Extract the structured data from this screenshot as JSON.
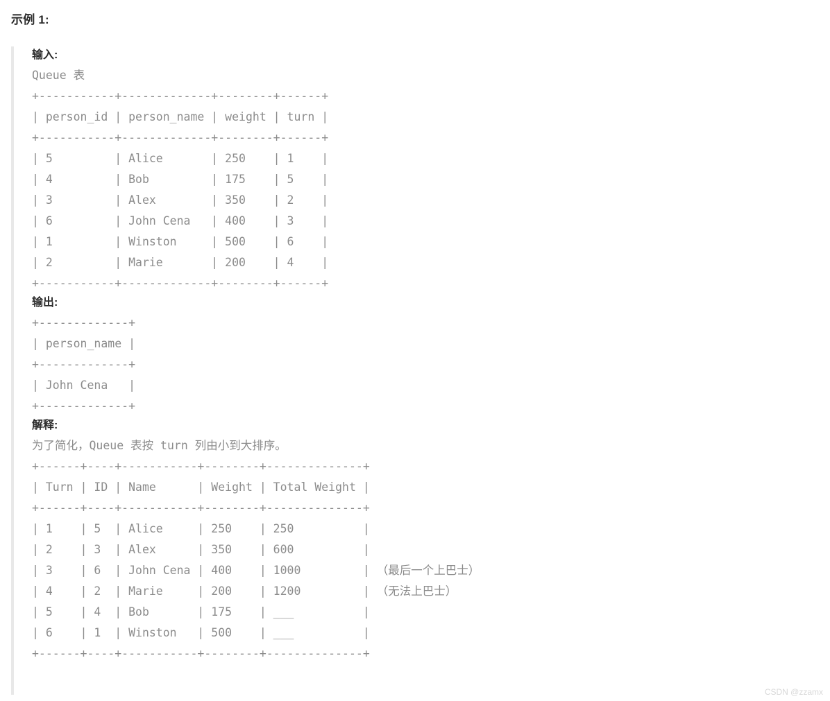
{
  "example": {
    "title": "示例 1:"
  },
  "input": {
    "heading": "输入:",
    "table_caption": "Queue 表",
    "ascii": "+-----------+-------------+--------+------+\n| person_id | person_name | weight | turn |\n+-----------+-------------+--------+------+\n| 5         | Alice       | 250    | 1    |\n| 4         | Bob         | 175    | 5    |\n| 3         | Alex        | 350    | 2    |\n| 6         | John Cena   | 400    | 3    |\n| 1         | Winston     | 500    | 6    |\n| 2         | Marie       | 200    | 4    |\n+-----------+-------------+--------+------+"
  },
  "output": {
    "heading": "输出:",
    "ascii": "+-------------+\n| person_name |\n+-------------+\n| John Cena   |\n+-------------+"
  },
  "explanation": {
    "heading": "解释:",
    "note": "为了简化，Queue 表按 turn 列由小到大排序。",
    "ascii": "+------+----+-----------+--------+--------------+\n| Turn | ID | Name      | Weight | Total Weight |\n+------+----+-----------+--------+--------------+\n| 1    | 5  | Alice     | 250    | 250          |\n| 2    | 3  | Alex      | 350    | 600          |\n| 3    | 6  | John Cena | 400    | 1000         | （最后一个上巴士）\n| 4    | 2  | Marie     | 200    | 1200         | （无法上巴士）\n| 5    | 4  | Bob       | 175    | ___          |\n| 6    | 1  | Winston   | 500    | ___          |\n+------+----+-----------+--------+--------------+"
  },
  "tables": {
    "queue": {
      "name": "Queue",
      "columns": [
        "person_id",
        "person_name",
        "weight",
        "turn"
      ],
      "rows": [
        [
          "5",
          "Alice",
          "250",
          "1"
        ],
        [
          "4",
          "Bob",
          "175",
          "5"
        ],
        [
          "3",
          "Alex",
          "350",
          "2"
        ],
        [
          "6",
          "John Cena",
          "400",
          "3"
        ],
        [
          "1",
          "Winston",
          "500",
          "6"
        ],
        [
          "2",
          "Marie",
          "200",
          "4"
        ]
      ]
    },
    "result": {
      "columns": [
        "person_name"
      ],
      "rows": [
        [
          "John Cena"
        ]
      ]
    },
    "walkthrough": {
      "columns": [
        "Turn",
        "ID",
        "Name",
        "Weight",
        "Total Weight"
      ],
      "rows": [
        [
          "1",
          "5",
          "Alice",
          "250",
          "250",
          ""
        ],
        [
          "2",
          "3",
          "Alex",
          "350",
          "600",
          ""
        ],
        [
          "3",
          "6",
          "John Cena",
          "400",
          "1000",
          "（最后一个上巴士）"
        ],
        [
          "4",
          "2",
          "Marie",
          "200",
          "1200",
          "（无法上巴士）"
        ],
        [
          "5",
          "4",
          "Bob",
          "175",
          "___",
          ""
        ],
        [
          "6",
          "1",
          "Winston",
          "500",
          "___",
          ""
        ]
      ]
    }
  },
  "watermark": {
    "text": "CSDN @zzamx"
  },
  "colors": {
    "heading": "#2b2b2b",
    "mono_text": "#8c8c8c",
    "quote_border": "#e8e8e8",
    "watermark": "#d8d8d8",
    "background": "#ffffff"
  }
}
